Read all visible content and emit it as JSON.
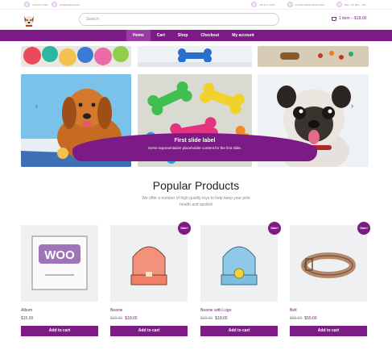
{
  "topbar": {
    "items": [
      {
        "text": "+44 11 1 1234"
      },
      {
        "text": "info@petshop.com"
      },
      {
        "text": "+44 11 1 1234"
      },
      {
        "text": "14 Main Street Some Town"
      },
      {
        "text": "Mon - Fri 9am - 5pm"
      }
    ]
  },
  "search": {
    "placeholder": "Search"
  },
  "cart": {
    "label": "1 item – $18.00"
  },
  "nav": {
    "items": [
      "Home",
      "Cart",
      "Shop",
      "Checkout",
      "My account"
    ]
  },
  "carousel": {
    "caption_title": "First slide label",
    "caption_text": "Some representative placeholder content for the first slide.",
    "prev": "‹",
    "next": "›"
  },
  "popular": {
    "title": "Popular Products",
    "subtitle": "We offer a number of high quality toys to help keep your pets health and spoiled"
  },
  "products": [
    {
      "name": "Album",
      "price": "$15.00",
      "old_price": "",
      "sale": false,
      "sale_label": "",
      "button": "Add to cart"
    },
    {
      "name": "Beanie",
      "price": "$18.00",
      "old_price": "$20.00",
      "sale": true,
      "sale_label": "Sale!",
      "button": "Add to cart"
    },
    {
      "name": "Beanie with Logo",
      "price": "$18.00",
      "old_price": "$20.00",
      "sale": true,
      "sale_label": "Sale!",
      "button": "Add to cart"
    },
    {
      "name": "Belt",
      "price": "$55.00",
      "old_price": "$65.00",
      "sale": true,
      "sale_label": "Sale!",
      "button": "Add to cart"
    }
  ],
  "colors": {
    "brand": "#7d1b86",
    "nav_active": "#9a3ba3"
  }
}
